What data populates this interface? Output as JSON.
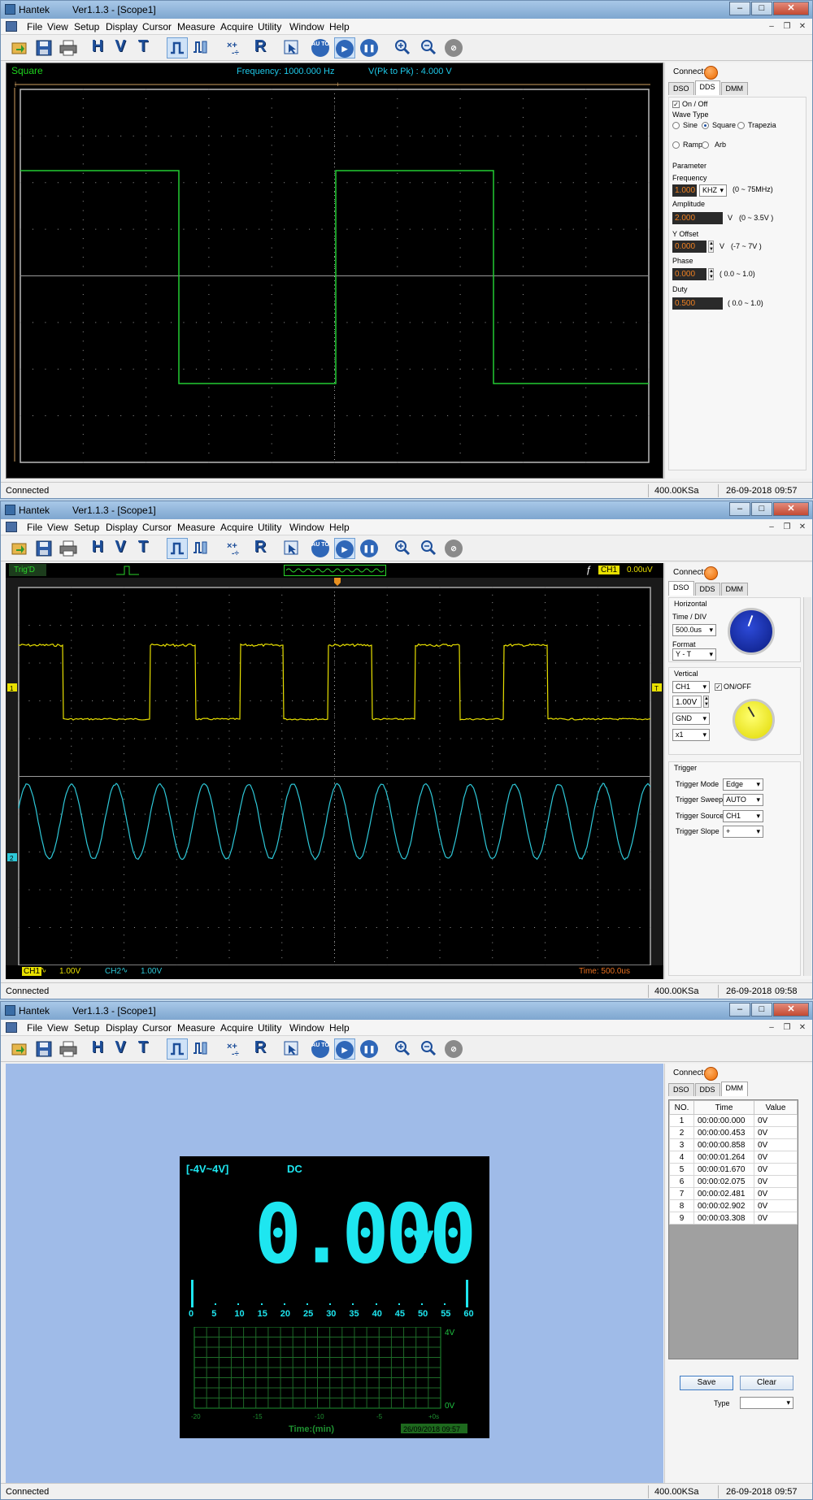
{
  "app": {
    "name": "Hantek",
    "version": "Ver1.1.3 - [Scope1]",
    "menus": [
      "File",
      "View",
      "Setup",
      "Display",
      "Cursor",
      "Measure",
      "Acquire",
      "Utility",
      "Window",
      "Help"
    ],
    "toolbar": [
      {
        "icon": "open-icon"
      },
      {
        "icon": "save-icon"
      },
      {
        "icon": "print-icon"
      },
      {
        "icon": "horizontal-icon",
        "label": "H"
      },
      {
        "icon": "vertical-icon",
        "label": "V"
      },
      {
        "icon": "trigger-icon",
        "label": "T"
      },
      {
        "icon": "scope-mode-icon"
      },
      {
        "icon": "roll-mode-icon"
      },
      {
        "icon": "math-icon"
      },
      {
        "icon": "reference-icon",
        "label": "R"
      },
      {
        "icon": "cursor-icon"
      },
      {
        "icon": "auto-icon",
        "label": "AU TO"
      },
      {
        "icon": "run-icon"
      },
      {
        "icon": "pause-icon"
      },
      {
        "icon": "zoom-in-icon"
      },
      {
        "icon": "zoom-out-icon"
      },
      {
        "icon": "erase-icon"
      }
    ],
    "connect_label": "Connect:",
    "tabs": [
      "DSO",
      "DDS",
      "DMM"
    ],
    "status_connected": "Connected",
    "sample_rate": "400.00KSa",
    "date": "26-09-2018"
  },
  "window1": {
    "time": "09:57",
    "wave_name": "Square",
    "frequency_readout": "Frequency: 1000.000 Hz",
    "vpp_readout": "V(Pk to Pk) : 4.000 V",
    "dds": {
      "on_off_label": "On / Off",
      "wave_type_label": "Wave Type",
      "wave_types": [
        "Sine",
        "Square",
        "Trapezia",
        "Ramp",
        "Arb"
      ],
      "selected_wave": "Square",
      "parameter_label": "Parameter",
      "frequency_label": "Frequency",
      "frequency_value": "1.000",
      "frequency_unit": "KHZ",
      "frequency_range": "(0 ~ 75MHz)",
      "amplitude_label": "Amplitude",
      "amplitude_value": "2.000",
      "amplitude_unit": "V",
      "amplitude_range": "(0 ~ 3.5V )",
      "offset_label": "Y Offset",
      "offset_value": "0.000",
      "offset_unit": "V",
      "offset_range": "(-7 ~ 7V )",
      "phase_label": "Phase",
      "phase_value": "0.000",
      "phase_range": "( 0.0 ~ 1.0)",
      "duty_label": "Duty",
      "duty_value": "0.500",
      "duty_range": "( 0.0 ~ 1.0)"
    }
  },
  "window2": {
    "time": "09:58",
    "trig_status": "Trig'D",
    "trig_channel": "CH1",
    "trig_level": "0.00uV",
    "ch1_marker": "1",
    "ch2_marker": "2",
    "trig_marker": "T",
    "ch1_scale_label": "CH1",
    "ch1_scale": "1.00V",
    "ch2_scale_label": "CH2",
    "ch2_scale": "1.00V",
    "timebase_readout": "Time: 500.0us",
    "dso": {
      "horizontal_label": "Horizontal",
      "timediv_label": "Time / DIV",
      "timediv_value": "500.0us",
      "format_label": "Format",
      "format_value": "Y - T",
      "vertical_label": "Vertical",
      "channel_value": "CH1",
      "onoff_label": "ON/OFF",
      "volts_value": "1.00V",
      "coupling_value": "GND",
      "probe_value": "x1",
      "trigger_label": "Trigger",
      "trigger_mode_label": "Trigger Mode",
      "trigger_mode_value": "Edge",
      "trigger_sweep_label": "Trigger Sweep",
      "trigger_sweep_value": "AUTO",
      "trigger_source_label": "Trigger Source",
      "trigger_source_value": "CH1",
      "trigger_slope_label": "Trigger Slope",
      "trigger_slope_value": "+"
    }
  },
  "window3": {
    "time": "09:57",
    "range_label": "[-4V~4V]",
    "mode_label": "DC",
    "reading": "0.000",
    "unit": "V",
    "scale_labels": [
      "0",
      "5",
      "10",
      "15",
      "20",
      "25",
      "30",
      "35",
      "40",
      "45",
      "50",
      "55",
      "60"
    ],
    "chart_top_label": "4V",
    "chart_bottom_label": "0V",
    "chart_x_labels": [
      "-20",
      "-15",
      "-10",
      "-5",
      "+0s"
    ],
    "chart_xlabel": "Time:(min)",
    "chart_date": "26/09/2018  09:57",
    "table_headers": [
      "NO.",
      "Time",
      "Value"
    ],
    "table_rows": [
      {
        "no": "1",
        "time": "00:00:00.000",
        "value": "0V"
      },
      {
        "no": "2",
        "time": "00:00:00.453",
        "value": "0V"
      },
      {
        "no": "3",
        "time": "00:00:00.858",
        "value": "0V"
      },
      {
        "no": "4",
        "time": "00:00:01.264",
        "value": "0V"
      },
      {
        "no": "5",
        "time": "00:00:01.670",
        "value": "0V"
      },
      {
        "no": "6",
        "time": "00:00:02.075",
        "value": "0V"
      },
      {
        "no": "7",
        "time": "00:00:02.481",
        "value": "0V"
      },
      {
        "no": "8",
        "time": "00:00:02.902",
        "value": "0V"
      },
      {
        "no": "9",
        "time": "00:00:03.308",
        "value": "0V"
      }
    ],
    "save_label": "Save",
    "clear_label": "Clear",
    "type_label": "Type",
    "type_value": ""
  },
  "colors": {
    "ch1": "#e8e000",
    "ch2": "#2ec8d8",
    "dds_wave": "#22cc33",
    "dmm_digits": "#1ee6f0",
    "dmm_bg": "#9fbbe8"
  }
}
